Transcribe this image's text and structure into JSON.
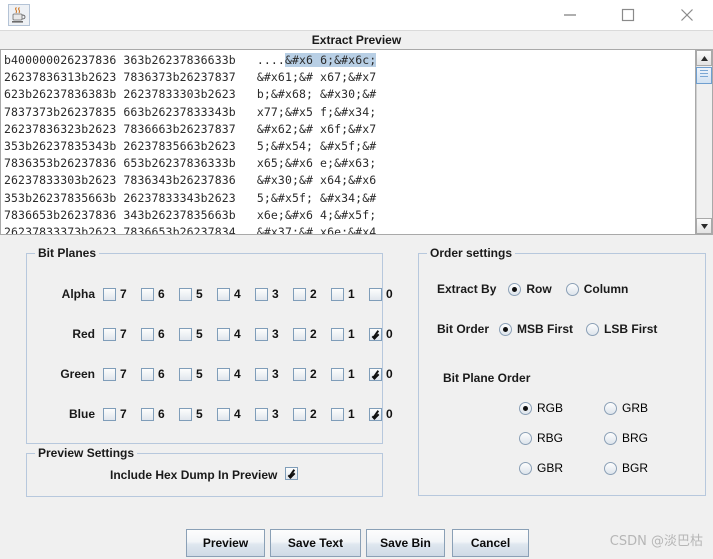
{
  "window": {
    "app_icon": "java-coffee-cup-icon",
    "minimize_label": "—",
    "maximize_label": "□",
    "close_label": "✕"
  },
  "dialog": {
    "title": "Extract Preview"
  },
  "preview_text": {
    "lines": [
      {
        "col1": "b400000026237836",
        "col2": "363b26237836633b",
        "ascii_plain": "....",
        "ascii_sel": "&#x6 6;&#x6c;"
      },
      {
        "col1": "26237836313b2623",
        "col2": "7836373b26237837",
        "ascii_plain": "&#x61;&# x67;&#x7",
        "ascii_sel": ""
      },
      {
        "col1": "623b26237836383b",
        "col2": "26237833303b2623",
        "ascii_plain": "b;&#x68; &#x30;&#",
        "ascii_sel": ""
      },
      {
        "col1": "7837373b26237835",
        "col2": "663b26237833343b",
        "ascii_plain": "x77;&#x5 f;&#x34;",
        "ascii_sel": ""
      },
      {
        "col1": "26237836323b2623",
        "col2": "7836663b26237837",
        "ascii_plain": "&#x62;&# x6f;&#x7",
        "ascii_sel": ""
      },
      {
        "col1": "353b26237835343b",
        "col2": "26237835663b2623",
        "ascii_plain": "5;&#x54; &#x5f;&#",
        "ascii_sel": ""
      },
      {
        "col1": "7836353b26237836",
        "col2": "653b26237836333b",
        "ascii_plain": "x65;&#x6 e;&#x63;",
        "ascii_sel": ""
      },
      {
        "col1": "26237833303b2623",
        "col2": "7836343b26237836",
        "ascii_plain": "&#x30;&# x64;&#x6",
        "ascii_sel": ""
      },
      {
        "col1": "353b26237835663b",
        "col2": "26237833343b2623",
        "ascii_plain": "5;&#x5f; &#x34;&#",
        "ascii_sel": ""
      },
      {
        "col1": "7836653b26237836",
        "col2": "343b26237835663b",
        "ascii_plain": "x6e;&#x6 4;&#x5f;",
        "ascii_sel": ""
      },
      {
        "col1": "26237833373b2623",
        "col2": "7836653b26237834",
        "ascii_plain": "&#x37;&# x6e;&#x4",
        "ascii_sel": ""
      }
    ],
    "scrollbar": {
      "up_arrow": "scroll-up-icon",
      "down_arrow": "scroll-down-icon"
    }
  },
  "bit_planes": {
    "legend": "Bit Planes",
    "bit_labels": [
      "7",
      "6",
      "5",
      "4",
      "3",
      "2",
      "1",
      "0"
    ],
    "channels": [
      {
        "name": "Alpha",
        "checked": [
          false,
          false,
          false,
          false,
          false,
          false,
          false,
          false
        ]
      },
      {
        "name": "Red",
        "checked": [
          false,
          false,
          false,
          false,
          false,
          false,
          false,
          true
        ]
      },
      {
        "name": "Green",
        "checked": [
          false,
          false,
          false,
          false,
          false,
          false,
          false,
          true
        ]
      },
      {
        "name": "Blue",
        "checked": [
          false,
          false,
          false,
          false,
          false,
          false,
          false,
          true
        ]
      }
    ]
  },
  "order_settings": {
    "legend": "Order settings",
    "extract_by": {
      "label": "Extract By",
      "options": [
        "Row",
        "Column"
      ],
      "selected": "Row"
    },
    "bit_order": {
      "label": "Bit Order",
      "options": [
        "MSB First",
        "LSB First"
      ],
      "selected": "MSB First"
    },
    "bit_plane_order": {
      "label": "Bit Plane Order",
      "options": [
        "RGB",
        "GRB",
        "RBG",
        "BRG",
        "GBR",
        "BGR"
      ],
      "selected": "RGB"
    }
  },
  "preview_settings": {
    "legend": "Preview Settings",
    "include_hex_dump": {
      "label": "Include Hex Dump In Preview",
      "checked": true
    }
  },
  "buttons": [
    {
      "label": "Preview"
    },
    {
      "label": "Save Text"
    },
    {
      "label": "Save Bin"
    },
    {
      "label": "Cancel"
    }
  ],
  "watermark": "CSDN @淡巴枯"
}
